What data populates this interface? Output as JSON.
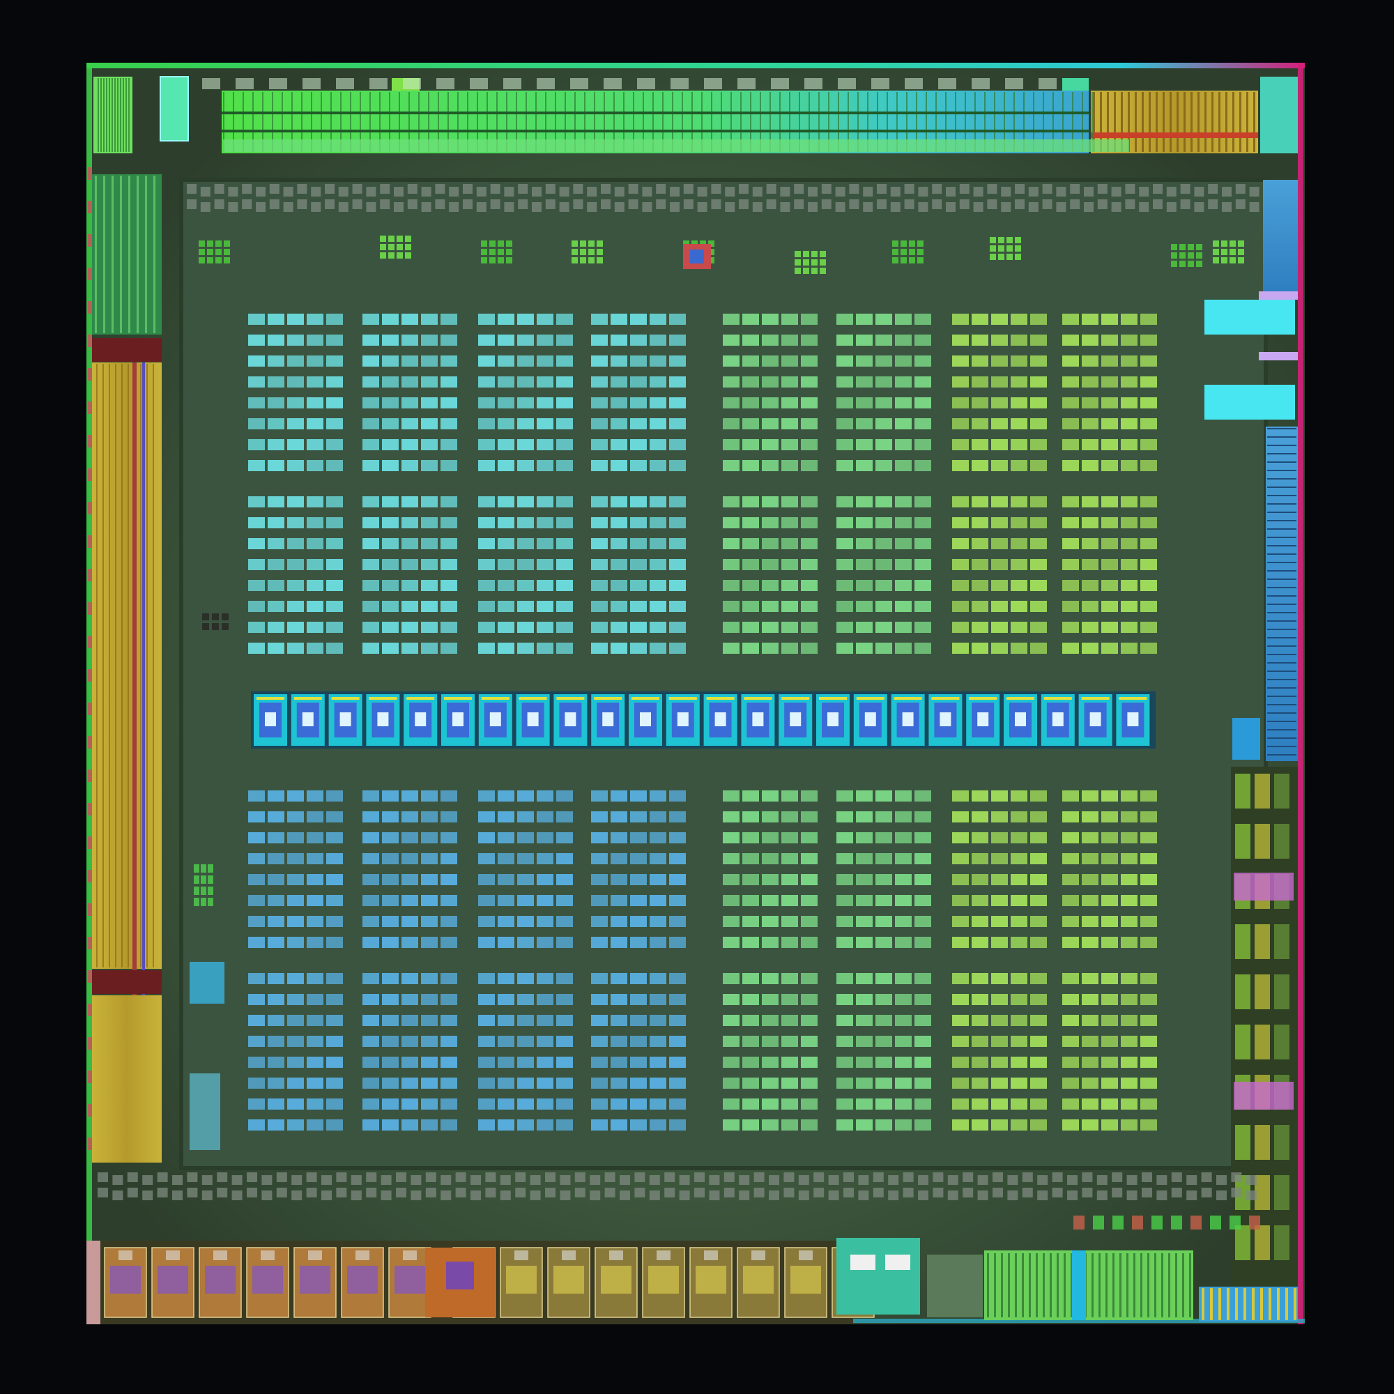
{
  "image": {
    "subject": "die-shot",
    "text": []
  },
  "palette": {
    "background": "#05070b",
    "die_body": "#3f5a3f",
    "die_body_dark": "#2c422f",
    "frame_green": "#2f8f3a",
    "edge_top_green": "#38d04a",
    "edge_top_cyan": "#2ec8d8",
    "edge_right_magenta": "#d4207a",
    "pad_grey": "#7d8a7f",
    "block_cyan": "#6fe3e6",
    "block_blue": "#5ab4e8",
    "block_green": "#a7e65c",
    "block_lime": "#7fe08a",
    "strip_yellow": "#c9b33a",
    "strip_red": "#a43a3a",
    "io_orange": "#c06a2a",
    "io_purple": "#7a4aa8",
    "center_band_cyan": "#1fd1e0",
    "center_band_blue": "#3b6bd6",
    "right_cyan_block": "#48e6f0"
  },
  "regions": {
    "upper_array": {
      "groups": 8,
      "row_blocks": 2,
      "rows_per_block": 8,
      "cells_per_row": 5
    },
    "lower_array": {
      "groups": 8,
      "row_blocks": 2,
      "rows_per_block": 8,
      "cells_per_row": 5
    },
    "center_band": {
      "tiles": 24
    },
    "bottom_io": {
      "tiles": 16
    },
    "top_bus": {
      "segments": 4
    }
  }
}
